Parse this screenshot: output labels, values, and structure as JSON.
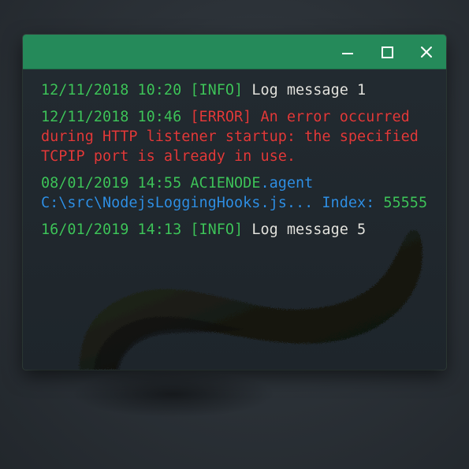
{
  "window": {
    "controls": {
      "minimize": "minimize-icon",
      "maximize": "maximize-icon",
      "close": "close-icon"
    },
    "titlebar_color": "#258a5a"
  },
  "log_entries": [
    {
      "timestamp": "12/11/2018 10:20",
      "level": "[INFO]",
      "message": "Log message 1"
    },
    {
      "timestamp": "12/11/2018 10:46",
      "level": "[ERROR]",
      "message": "An error occurred during HTTP listener startup: the specified TCPIP port is already in use."
    },
    {
      "timestamp": "08/01/2019 14:55",
      "source": "AC1ENODE",
      "source_suffix": ".agent",
      "path": "C:\\src\\NodejsLoggingHooks.js...",
      "index_label": "Index:",
      "index_value": "55555"
    },
    {
      "timestamp": "16/01/2019 14:13",
      "level": "[INFO]",
      "message": "Log message 5"
    }
  ],
  "colors": {
    "timestamp": "#3ec35a",
    "info_text": "#e3e3de",
    "error_text": "#e23a3a",
    "link_text": "#2f8fe3",
    "background": "#222a30"
  }
}
